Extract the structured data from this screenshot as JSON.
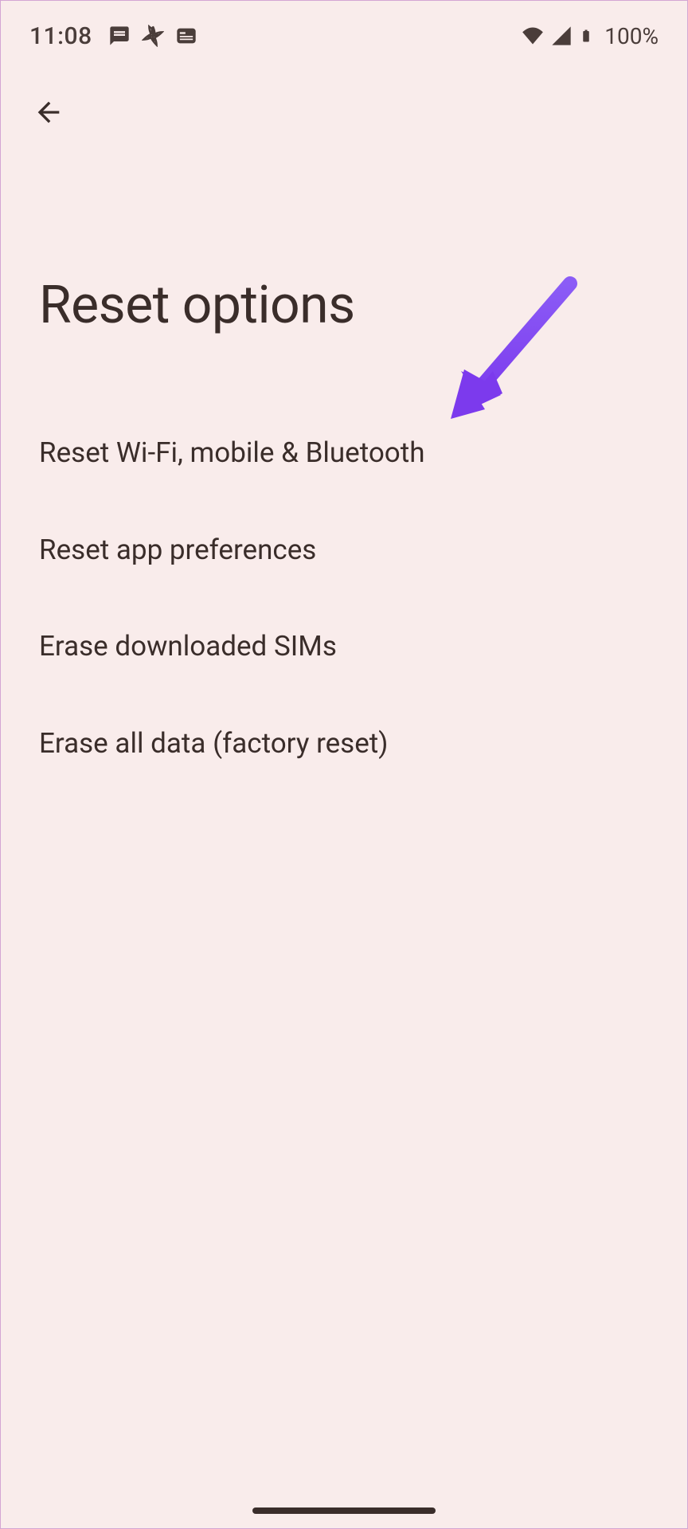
{
  "status": {
    "time": "11:08",
    "battery_percent": "100%"
  },
  "header": {
    "title": "Reset options"
  },
  "options": [
    {
      "label": "Reset Wi-Fi, mobile & Bluetooth"
    },
    {
      "label": "Reset app preferences"
    },
    {
      "label": "Erase downloaded SIMs"
    },
    {
      "label": "Erase all data (factory reset)"
    }
  ]
}
